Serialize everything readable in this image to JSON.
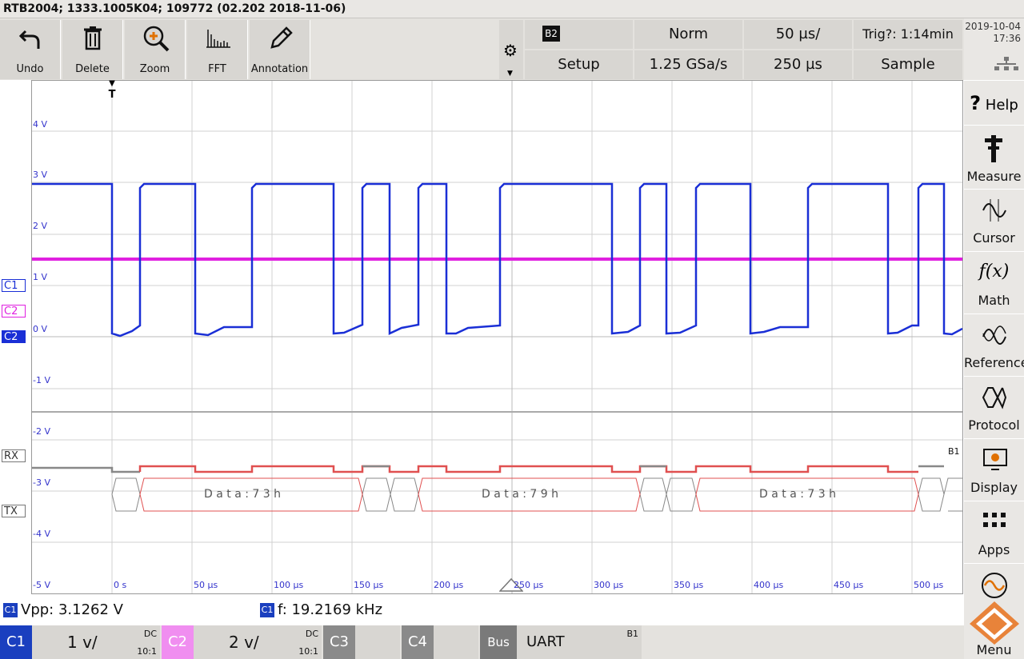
{
  "title": "RTB2004; 1333.1005K04; 109772 (02.202 2018-11-06)",
  "toolbar": {
    "undo": "Undo",
    "delete": "Delete",
    "zoom": "Zoom",
    "fft": "FFT",
    "annotation": "Annotation"
  },
  "settings": {
    "bus_badge": "B2",
    "trigger_mode": "Norm",
    "timebase": "50 µs/",
    "trigger_status": "Trig?: 1:14min",
    "setup": "Setup",
    "sample_rate": "1.25 GSa/s",
    "record_length": "250 µs",
    "acquisition": "Sample"
  },
  "datetime": {
    "date": "2019-10-04",
    "time": "17:36"
  },
  "sidebar": {
    "help": "Help",
    "measure": "Measure",
    "cursor": "Cursor",
    "math": "Math",
    "references": "References",
    "protocol": "Protocol",
    "display": "Display",
    "apps": "Apps"
  },
  "channels_markers": {
    "c1": "C1",
    "c2": "C2",
    "c3": "C2",
    "rx": "RX",
    "tx": "TX"
  },
  "y_axis": [
    "4 V",
    "3 V",
    "2 V",
    "1 V",
    "0 V",
    "-1 V",
    "-2 V",
    "-3 V",
    "-4 V",
    "-5 V"
  ],
  "x_axis": [
    "0 s",
    "50 µs",
    "100 µs",
    "150 µs",
    "200 µs",
    "250 µs",
    "300 µs",
    "350 µs",
    "400 µs",
    "450 µs",
    "500 µs"
  ],
  "trigger_marker": "T",
  "bus_label": "B1",
  "decode": [
    "D a t a : 7 3 h",
    "D a t a : 7 9 h",
    "D a t a : 7 3 h"
  ],
  "measurements": {
    "vpp_badge": "C1",
    "vpp": "Vpp: 3.1262 V",
    "freq_badge": "C1",
    "freq": "f: 19.2169 kHz"
  },
  "bottom": {
    "c1": {
      "tag": "C1",
      "scale": "1 v/",
      "coupling": "DC",
      "ratio": "10:1"
    },
    "c2": {
      "tag": "C2",
      "scale": "2 v/",
      "coupling": "DC",
      "ratio": "10:1"
    },
    "c3": {
      "tag": "C3"
    },
    "c4": {
      "tag": "C4"
    },
    "bus": {
      "tag": "Bus",
      "protocol": "UART",
      "label": "B1"
    }
  },
  "menu": "Menu",
  "colors": {
    "ch1": "#1a2fd6",
    "ch2": "#e020e0",
    "bus": "#e05050",
    "accent": "#1a3fbf"
  }
}
